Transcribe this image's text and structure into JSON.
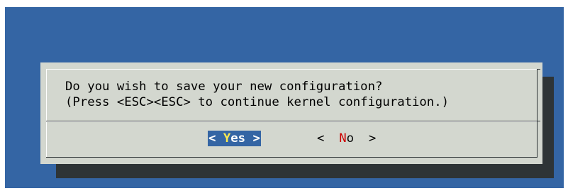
{
  "dialog": {
    "line1": "Do you wish to save your new configuration?",
    "line2": "(Press <ESC><ESC> to continue kernel configuration.)"
  },
  "buttons": {
    "yes": {
      "left": "<",
      "hotkey": "Y",
      "rest": "es",
      "right": ">"
    },
    "no": {
      "left": "<",
      "hotkey": "N",
      "rest": "o",
      "right": ">"
    }
  },
  "colors": {
    "background": "#3465a4",
    "dialog": "#d3d7cf",
    "shadow": "#2e3436",
    "selected_button_bg": "#3465a4",
    "hotkey_selected": "#fce94f",
    "hotkey_unselected": "#cc0000"
  }
}
